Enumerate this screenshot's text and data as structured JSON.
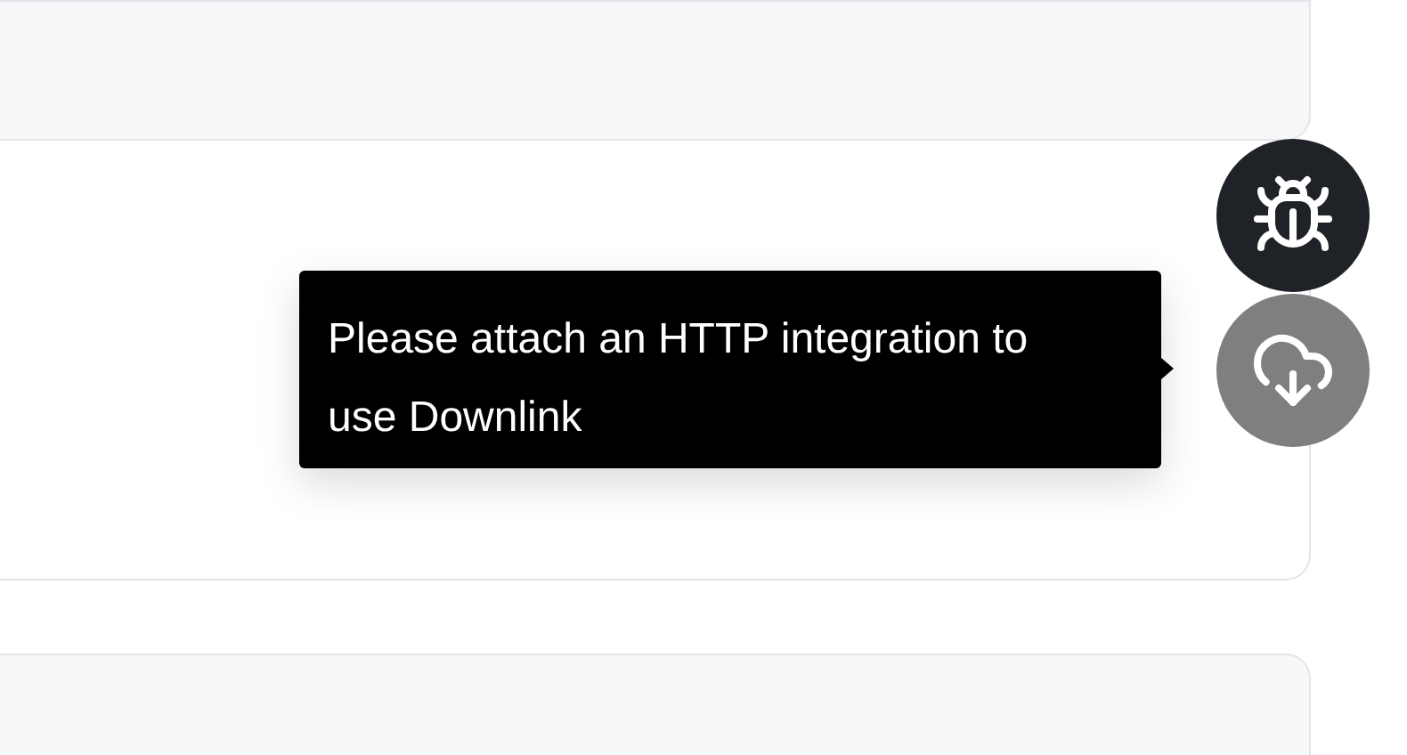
{
  "buttons": [
    {
      "kind": "debug",
      "disabled": false
    },
    {
      "kind": "downlink",
      "disabled": true
    }
  ],
  "tooltip": {
    "text": "Please attach an HTTP integration to use Downlink"
  }
}
